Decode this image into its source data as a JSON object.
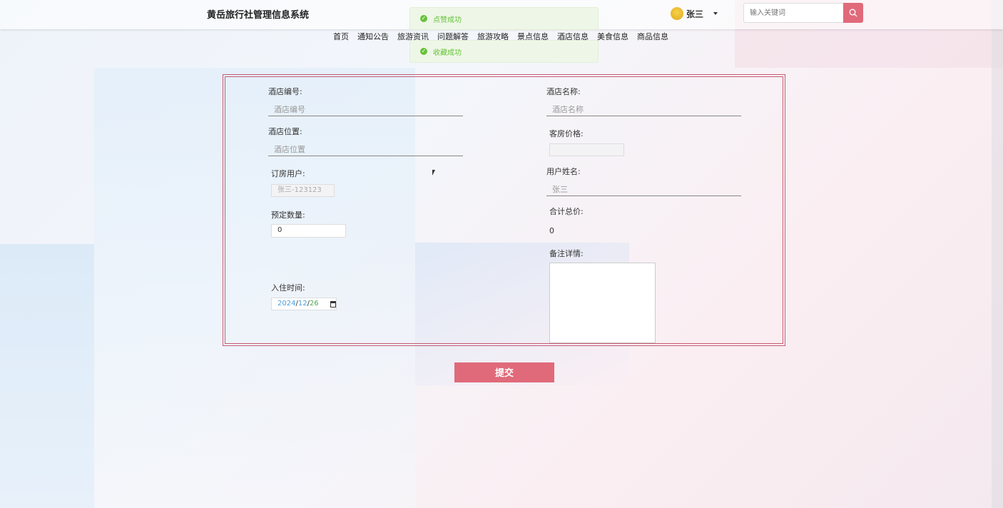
{
  "header": {
    "site_title": "黄岳旅行社管理信息系统",
    "user_name": "张三",
    "search_placeholder": "输入关键词"
  },
  "nav": [
    "首页",
    "通知公告",
    "旅游资讯",
    "问题解答",
    "旅游攻略",
    "景点信息",
    "酒店信息",
    "美食信息",
    "商品信息"
  ],
  "toasts": [
    "点赞成功",
    "收藏成功"
  ],
  "form": {
    "hotel_no_label": "酒店编号:",
    "hotel_no_placeholder": "酒店编号",
    "hotel_name_label": "酒店名称:",
    "hotel_name_placeholder": "酒店名称",
    "location_label": "酒店位置:",
    "location_placeholder": "酒店位置",
    "room_price_label": "客房价格:",
    "room_price_value": "",
    "booking_user_label": "订房用户:",
    "booking_user_value": "张三-123123",
    "user_name_label": "用户姓名:",
    "user_name_value": "张三",
    "quantity_label": "预定数量:",
    "quantity_value": "0",
    "total_label": "合计总价:",
    "total_value": "0",
    "remarks_label": "备注详情:",
    "checkin_label": "入住时间:",
    "checkin_year": "2024",
    "checkin_month": "12",
    "checkin_day": "26",
    "submit_label": "提交"
  },
  "colors": {
    "accent": "#e06a7a",
    "border": "#c75a72",
    "success": "#67c23a"
  }
}
